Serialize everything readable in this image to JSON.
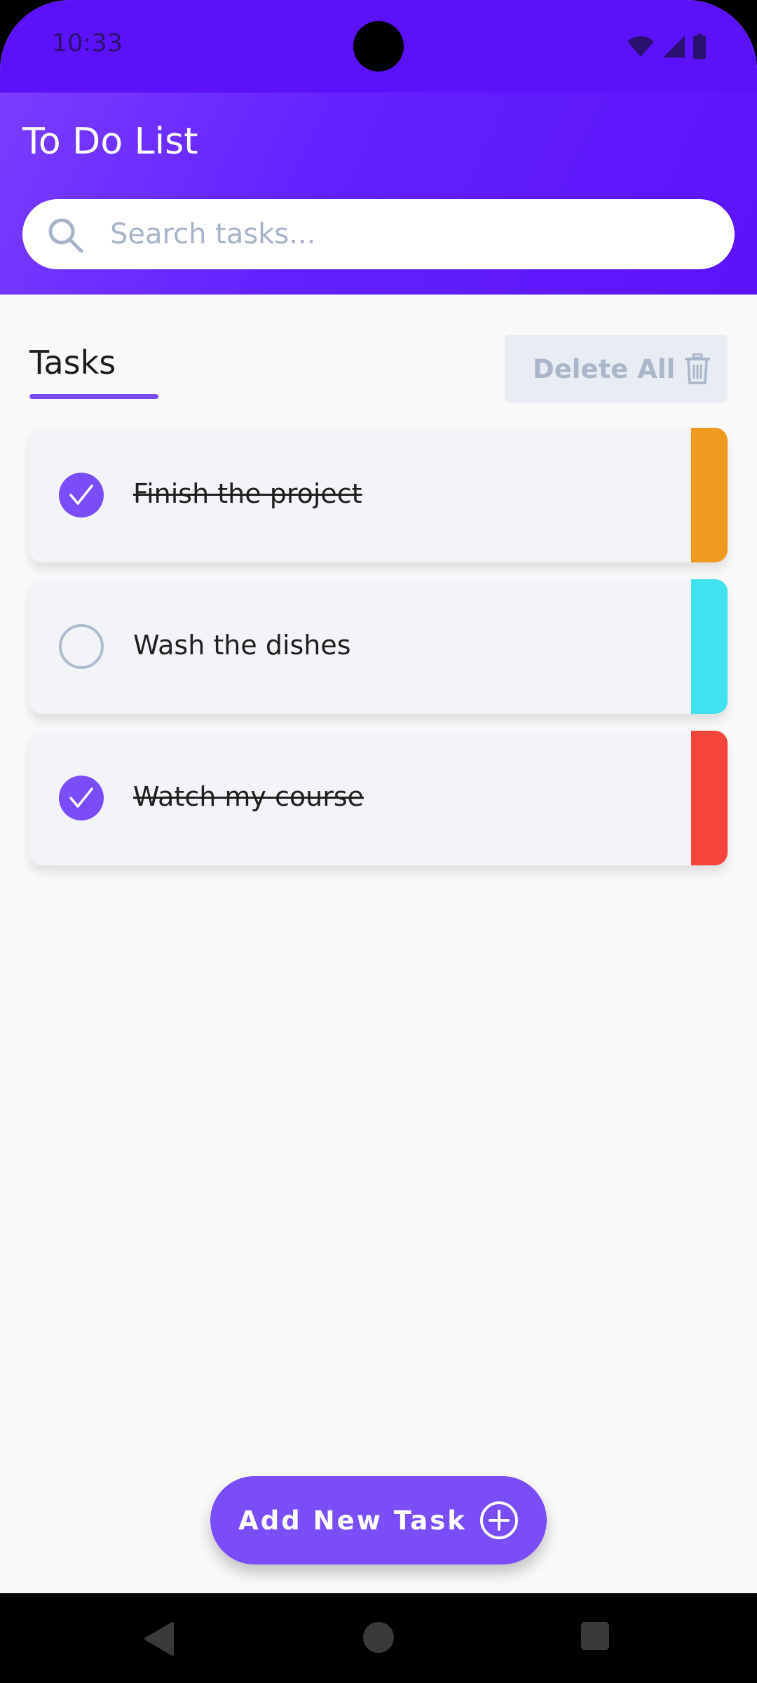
{
  "status_bar": {
    "time": "10:33"
  },
  "header": {
    "title": "To Do List",
    "search_placeholder": "Search tasks..."
  },
  "tabs": {
    "active_label": "Tasks"
  },
  "toolbar": {
    "delete_all_label": "Delete All"
  },
  "tasks": [
    {
      "label": "Finish the project",
      "completed": true,
      "priority_color": "#ef9a1e"
    },
    {
      "label": "Wash the dishes",
      "completed": false,
      "priority_color": "#3fe2ee"
    },
    {
      "label": "Watch my course",
      "completed": true,
      "priority_color": "#f4443b"
    }
  ],
  "footer": {
    "add_task_label": "Add New Task"
  },
  "colors": {
    "header_primary": "#5b12f9",
    "accent": "#7b4df8",
    "background": "#f9f9f9"
  }
}
